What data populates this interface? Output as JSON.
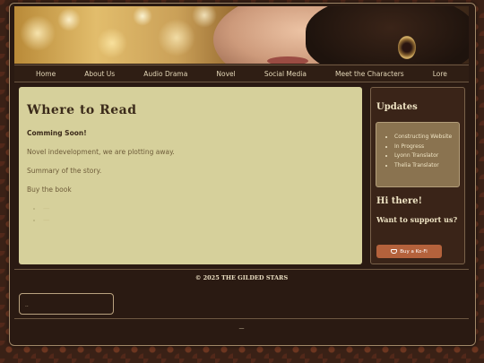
{
  "nav": [
    {
      "label": "Home"
    },
    {
      "label": "About Us"
    },
    {
      "label": "Audio Drama"
    },
    {
      "label": "Novel"
    },
    {
      "label": "Social Media"
    },
    {
      "label": "Meet the Characters"
    },
    {
      "label": "Lore"
    }
  ],
  "main": {
    "title": "Where to Read",
    "coming_soon": "Comming Soon!",
    "development": "Novel indevelopment, we are plotting away.",
    "summary": "Summary of the story.",
    "buy_book": "Buy the book",
    "buy_links": [
      "—",
      "—"
    ]
  },
  "sidebar": {
    "updates_title": "Updates",
    "updates": [
      "Constructing Website",
      "In Progress",
      "Lyonn Translator",
      "Thelia Translator"
    ],
    "greeting": "Hi there!",
    "support_question": "Want to support us?",
    "kofi_label": "Buy a Ko-Fi"
  },
  "footer": {
    "copyright": "© 2025 THE GILDED STARS",
    "box_text": "..",
    "bottom_text": "—"
  },
  "colors": {
    "background": "#3a2116",
    "main_panel": "#d6d09b",
    "sidebar_panel": "#3a2418",
    "kofi_button": "#b4623c",
    "heading_text": "#3b2a1a"
  }
}
